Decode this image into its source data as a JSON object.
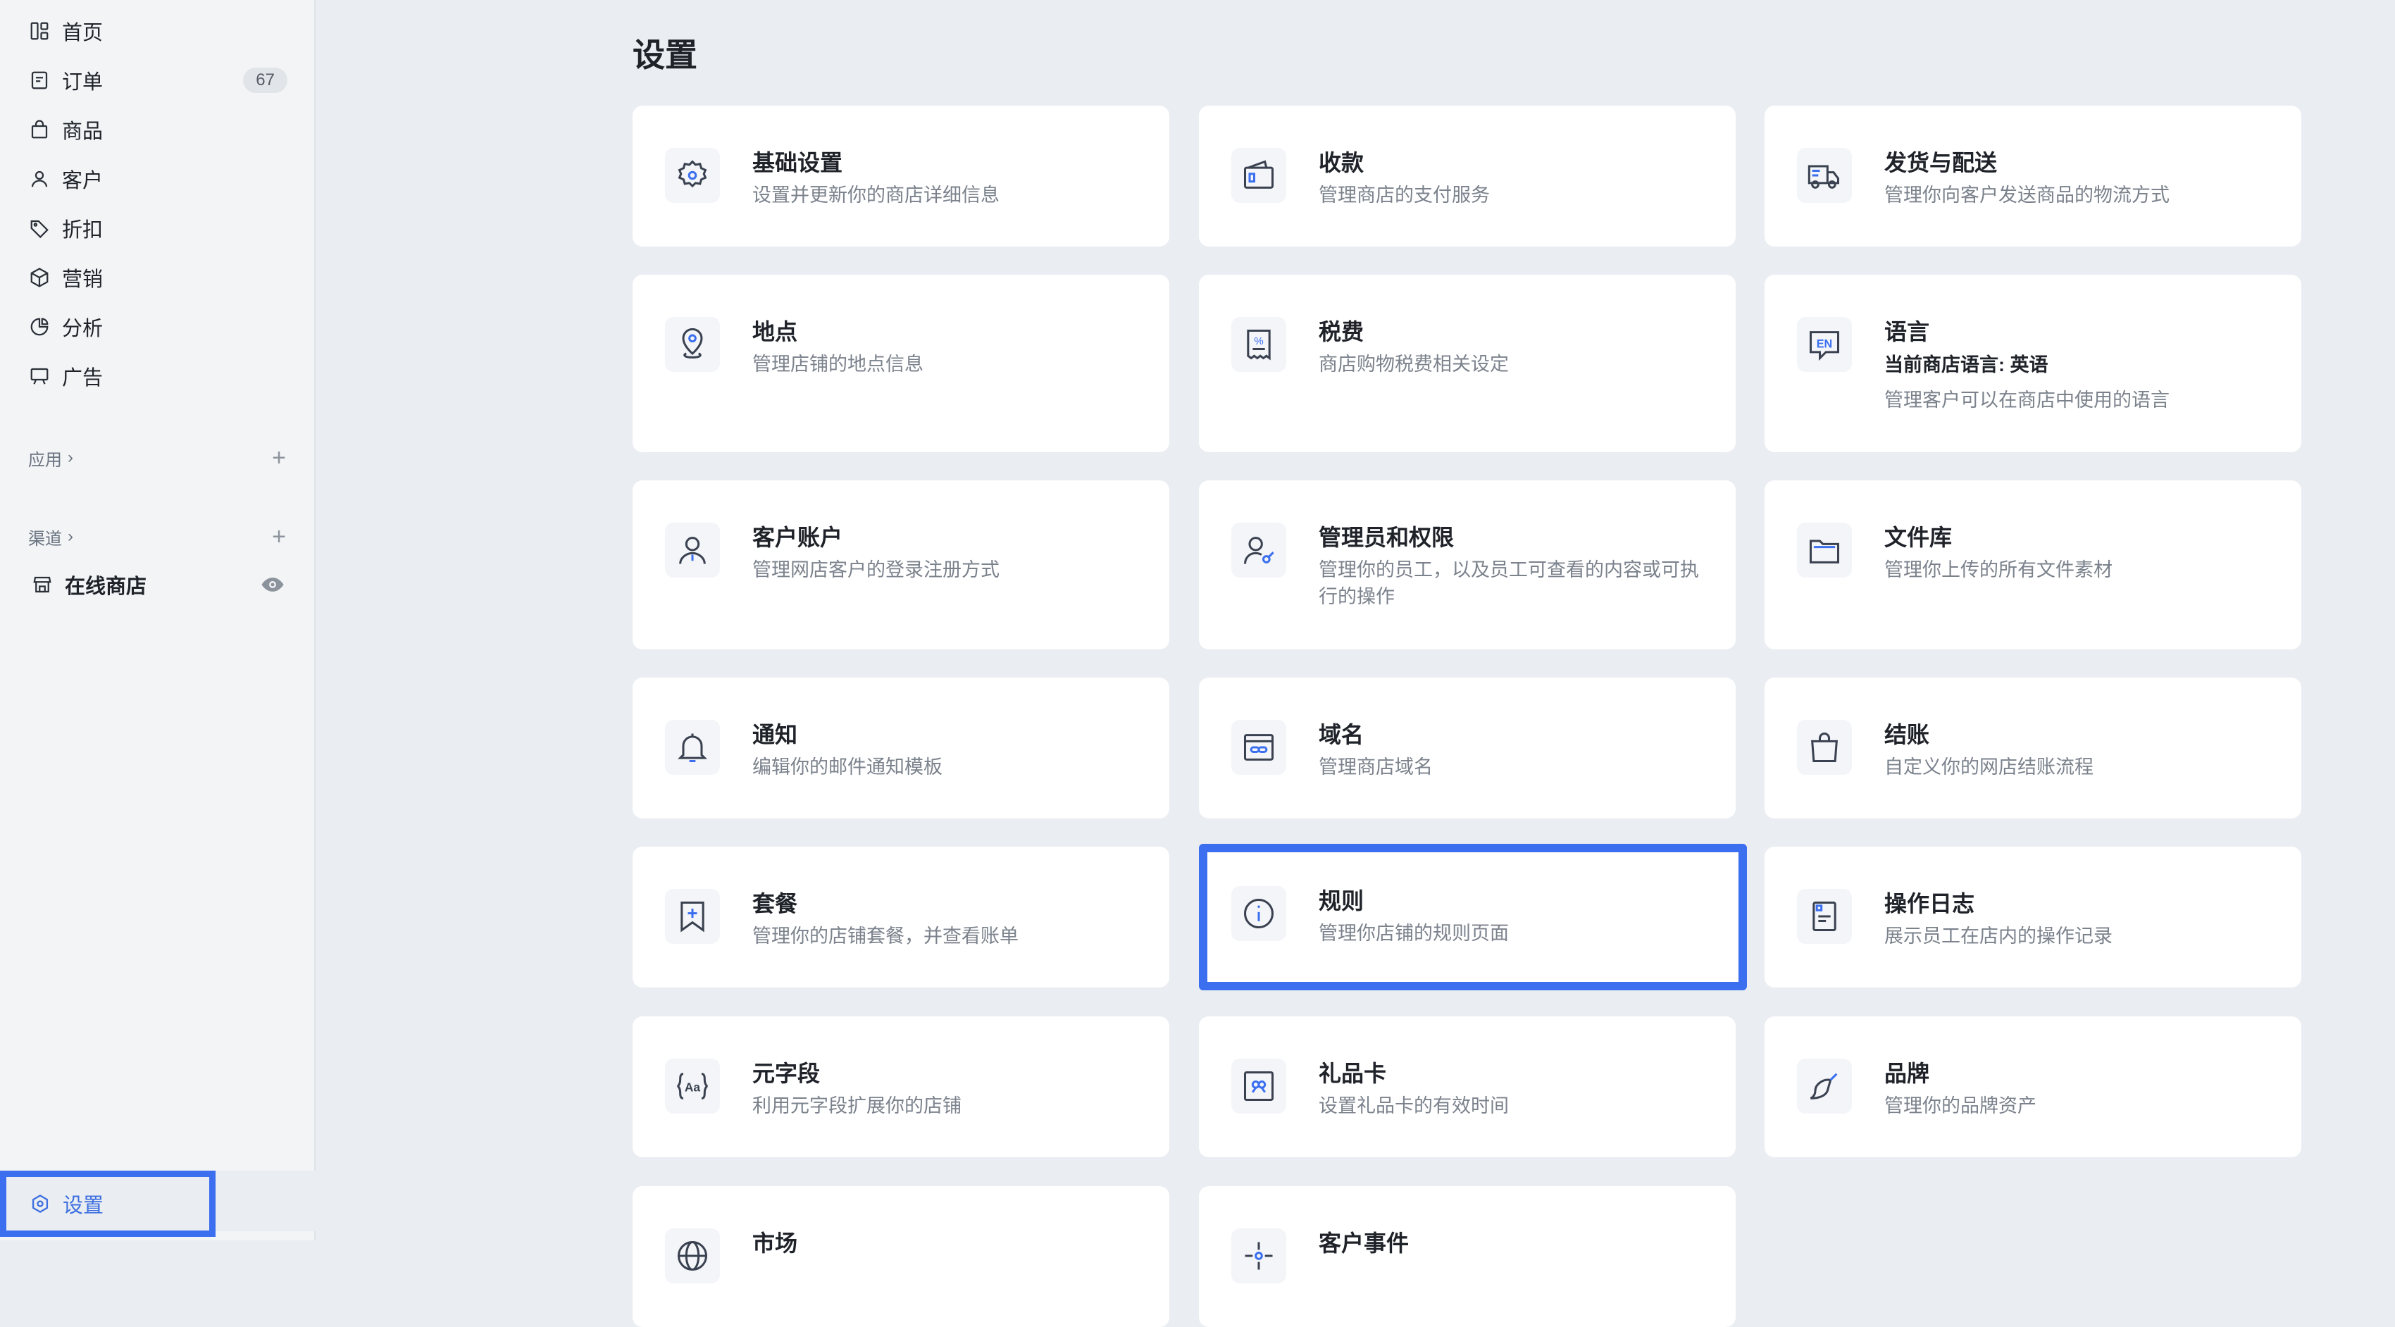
{
  "sidebar": {
    "nav": [
      {
        "label": "首页",
        "icon": "home-icon"
      },
      {
        "label": "订单",
        "icon": "order-icon",
        "badge": "67"
      },
      {
        "label": "商品",
        "icon": "bag-icon"
      },
      {
        "label": "客户",
        "icon": "user-icon"
      },
      {
        "label": "折扣",
        "icon": "tag-icon"
      },
      {
        "label": "营销",
        "icon": "cube-icon"
      },
      {
        "label": "分析",
        "icon": "pie-chart-icon"
      },
      {
        "label": "广告",
        "icon": "billboard-icon"
      }
    ],
    "apps_label": "应用",
    "channels_label": "渠道",
    "online_store": "在线商店",
    "settings_label": "设置"
  },
  "main": {
    "title": "设置",
    "cards": [
      {
        "title": "基础设置",
        "desc": "设置并更新你的商店详细信息",
        "icon": "gear-icon"
      },
      {
        "title": "收款",
        "desc": "管理商店的支付服务",
        "icon": "wallet-icon"
      },
      {
        "title": "发货与配送",
        "desc": "管理你向客户发送商品的物流方式",
        "icon": "truck-icon"
      },
      {
        "title": "地点",
        "desc": "管理店铺的地点信息",
        "icon": "location-pin-icon"
      },
      {
        "title": "税费",
        "desc": "商店购物税费相关设定",
        "icon": "tax-receipt-icon"
      },
      {
        "title": "语言",
        "subtitle": "当前商店语言: 英语",
        "desc": "管理客户可以在商店中使用的语言",
        "icon": "language-en-icon"
      },
      {
        "title": "客户账户",
        "desc": "管理网店客户的登录注册方式",
        "icon": "customer-account-icon"
      },
      {
        "title": "管理员和权限",
        "desc": "管理你的员工，以及员工可查看的内容或可执行的操作",
        "icon": "admin-key-icon"
      },
      {
        "title": "文件库",
        "desc": "管理你上传的所有文件素材",
        "icon": "folder-icon"
      },
      {
        "title": "通知",
        "desc": "编辑你的邮件通知模板",
        "icon": "bell-icon"
      },
      {
        "title": "域名",
        "desc": "管理商店域名",
        "icon": "domain-link-icon"
      },
      {
        "title": "结账",
        "desc": "自定义你的网店结账流程",
        "icon": "shopping-bag-icon"
      },
      {
        "title": "套餐",
        "desc": "管理你的店铺套餐，并查看账单",
        "icon": "bookmark-plus-icon"
      },
      {
        "title": "规则",
        "desc": "管理你店铺的规则页面",
        "icon": "info-icon"
      },
      {
        "title": "操作日志",
        "desc": "展示员工在店内的操作记录",
        "icon": "log-icon"
      },
      {
        "title": "元字段",
        "desc": "利用元字段扩展你的店铺",
        "icon": "metafield-icon"
      },
      {
        "title": "礼品卡",
        "desc": "设置礼品卡的有效时间",
        "icon": "gift-card-icon"
      },
      {
        "title": "品牌",
        "desc": "管理你的品牌资产",
        "icon": "brand-icon"
      },
      {
        "title": "市场",
        "desc": "",
        "icon": "globe-icon"
      },
      {
        "title": "客户事件",
        "desc": "",
        "icon": "sparkle-icon"
      }
    ]
  }
}
